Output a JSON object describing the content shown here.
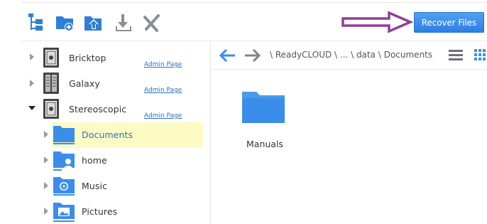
{
  "toolbar": {
    "icons": [
      "tree-view-icon",
      "new-folder-icon",
      "upload-icon",
      "download-icon",
      "delete-icon"
    ],
    "recover_label": "Recover Files",
    "accent": "#3a8ee9"
  },
  "tree": {
    "devices": [
      {
        "label": "Bricktop",
        "admin": "Admin Page",
        "expanded": false
      },
      {
        "label": "Galaxy",
        "admin": "Admin Page",
        "expanded": false
      },
      {
        "label": "Stereoscopic",
        "admin": "Admin Page",
        "expanded": true
      }
    ],
    "shares": [
      {
        "label": "Documents",
        "icon": "folder-icon",
        "selected": true
      },
      {
        "label": "home",
        "icon": "home-folder-icon",
        "selected": false
      },
      {
        "label": "Music",
        "icon": "music-folder-icon",
        "selected": false
      },
      {
        "label": "Pictures",
        "icon": "pictures-folder-icon",
        "selected": false
      }
    ],
    "selected_color": "#fdfbc4"
  },
  "browser": {
    "breadcrumb": "\\ ReadyCLOUD \\ ... \\ data \\ Documents",
    "items": [
      {
        "label": "Manuals",
        "icon": "folder-icon"
      }
    ]
  }
}
